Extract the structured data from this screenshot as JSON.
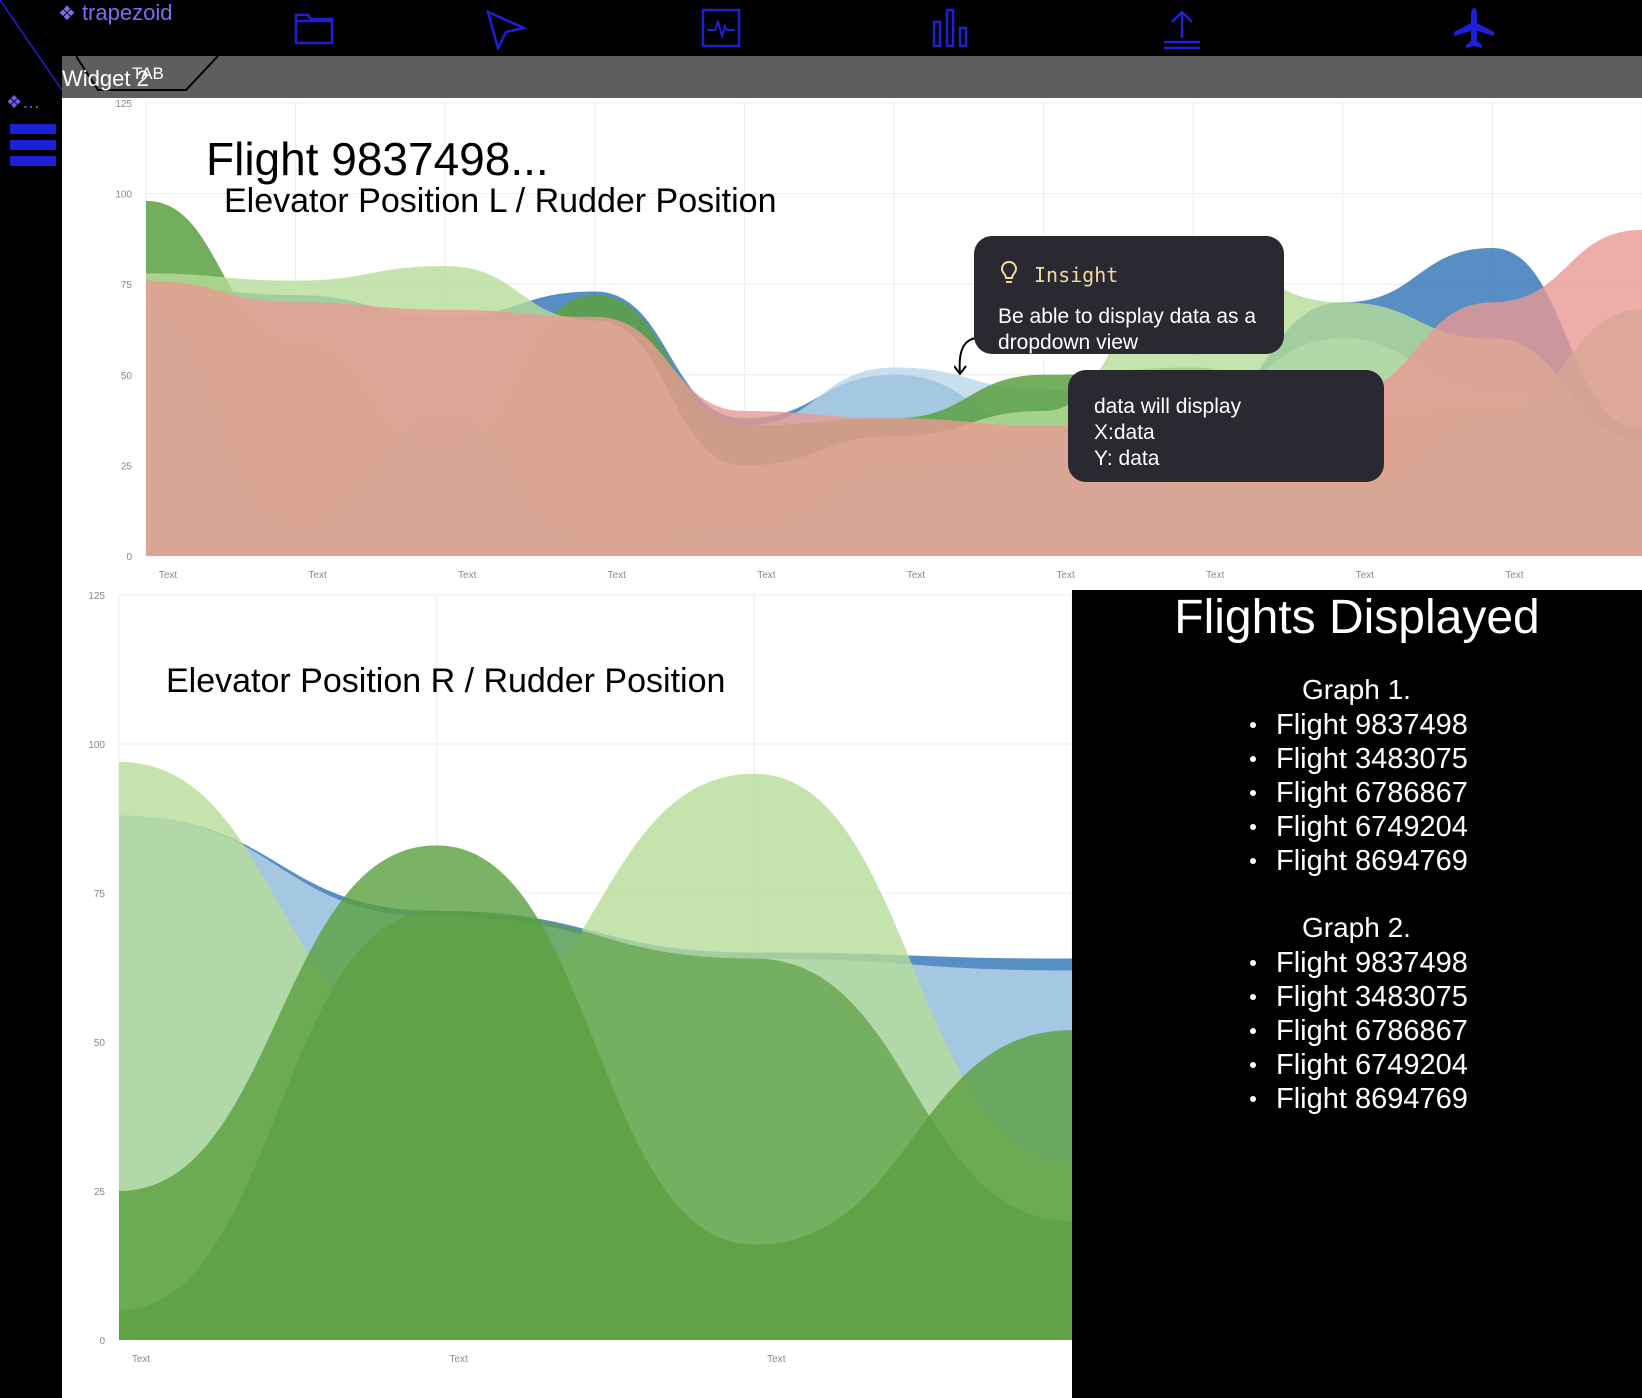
{
  "app": {
    "logo_text": "trapezoid",
    "sidebar_logo_text": "…",
    "accent_color": "#1f1fd6",
    "logo_color": "#7b6ff0"
  },
  "toolbar": {
    "icons": [
      "folder-icon",
      "cursor-icon",
      "activity-icon",
      "bar-chart-icon",
      "upload-icon",
      "airplane-icon"
    ]
  },
  "tab": {
    "widget_label": "Widget 2",
    "tab_label": "TAB"
  },
  "chart1": {
    "title": "Flight 9837498...",
    "subtitle": "Elevator Position L / Rudder Position"
  },
  "chart2": {
    "subtitle": "Elevator Position R / Rudder Position"
  },
  "insight_tooltip": {
    "heading": "Insight",
    "body": "Be able to display data as a dropdown view"
  },
  "data_tooltip": {
    "body": "data will display\nX:data\nY: data"
  },
  "flights_panel": {
    "title": "Flights Displayed",
    "graph1_title": "Graph 1.",
    "graph1_flights": [
      "Flight 9837498",
      "Flight 3483075",
      "Flight 6786867",
      "Flight 6749204",
      "Flight 8694769"
    ],
    "graph2_title": "Graph 2.",
    "graph2_flights": [
      "Flight 9837498",
      "Flight 3483075",
      "Flight 6786867",
      "Flight 6749204",
      "Flight 8694769"
    ]
  },
  "chart_data": [
    {
      "type": "area",
      "title": "Flight 9837498...",
      "subtitle": "Elevator Position L / Rudder Position",
      "xlabel": "",
      "ylabel": "",
      "categories": [
        "Text",
        "Text",
        "Text",
        "Text",
        "Text",
        "Text",
        "Text",
        "Text",
        "Text",
        "Text",
        "Text"
      ],
      "y_ticks": [
        0,
        25,
        50,
        75,
        100,
        125
      ],
      "ylim": [
        0,
        125
      ],
      "grid": true,
      "series": [
        {
          "color": "#3a7ab8",
          "opacity": 0.85,
          "values": [
            75,
            72,
            66,
            73,
            38,
            50,
            36,
            40,
            70,
            85,
            35
          ]
        },
        {
          "color": "#b8d6ea",
          "opacity": 0.8,
          "values": [
            74,
            70,
            64,
            66,
            36,
            52,
            46,
            44,
            60,
            45,
            30
          ]
        },
        {
          "color": "#5aa040",
          "opacity": 0.85,
          "values": [
            98,
            60,
            30,
            72,
            36,
            38,
            50,
            52,
            38,
            42,
            36
          ]
        },
        {
          "color": "#b7dc98",
          "opacity": 0.8,
          "values": [
            78,
            76,
            80,
            65,
            25,
            33,
            40,
            82,
            70,
            60,
            32
          ]
        },
        {
          "color": "#e89a94",
          "opacity": 0.8,
          "values": [
            76,
            70,
            68,
            66,
            40,
            38,
            36,
            34,
            45,
            70,
            90
          ]
        },
        {
          "color": "#d8a595",
          "opacity": 0.8,
          "values": [
            70,
            10,
            40,
            5,
            8,
            25,
            30,
            20,
            18,
            40,
            68
          ]
        }
      ]
    },
    {
      "type": "area",
      "title": "",
      "subtitle": "Elevator Position R / Rudder Position",
      "xlabel": "",
      "ylabel": "",
      "categories": [
        "Text",
        "Text",
        "Text",
        "Text"
      ],
      "y_ticks": [
        0,
        25,
        50,
        75,
        100,
        125
      ],
      "ylim": [
        0,
        125
      ],
      "grid": true,
      "series": [
        {
          "color": "#3a7ab8",
          "opacity": 0.85,
          "values": [
            88,
            72,
            65,
            64
          ]
        },
        {
          "color": "#b8d6ea",
          "opacity": 0.8,
          "values": [
            88,
            71,
            64,
            62
          ]
        },
        {
          "color": "#b7dc98",
          "opacity": 0.8,
          "values": [
            97,
            50,
            95,
            30
          ]
        },
        {
          "color": "#5aa040",
          "opacity": 0.8,
          "values": [
            25,
            83,
            16,
            52
          ]
        },
        {
          "color": "#5aa040",
          "opacity": 0.7,
          "values": [
            5,
            72,
            64,
            20
          ]
        }
      ]
    }
  ]
}
